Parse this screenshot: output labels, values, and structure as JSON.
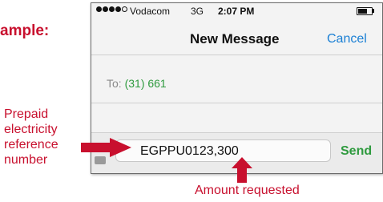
{
  "example_heading": "ample:",
  "status_bar": {
    "carrier": "Vodacom",
    "network": "3G",
    "time": "2:07 PM",
    "battery_level": 0.6
  },
  "nav": {
    "title": "New Message",
    "cancel_label": "Cancel"
  },
  "recipient": {
    "label": "To:",
    "value": "(31) 661"
  },
  "compose": {
    "message_text": "EGPPU0123,300",
    "send_label": "Send"
  },
  "annotations": {
    "left_lines": [
      "Prepaid",
      "electricity",
      "reference",
      "number"
    ],
    "bottom": "Amount requested"
  },
  "colors": {
    "annotation": "#c8102e",
    "link": "#1a7fd4",
    "send": "#2e9a3e"
  }
}
